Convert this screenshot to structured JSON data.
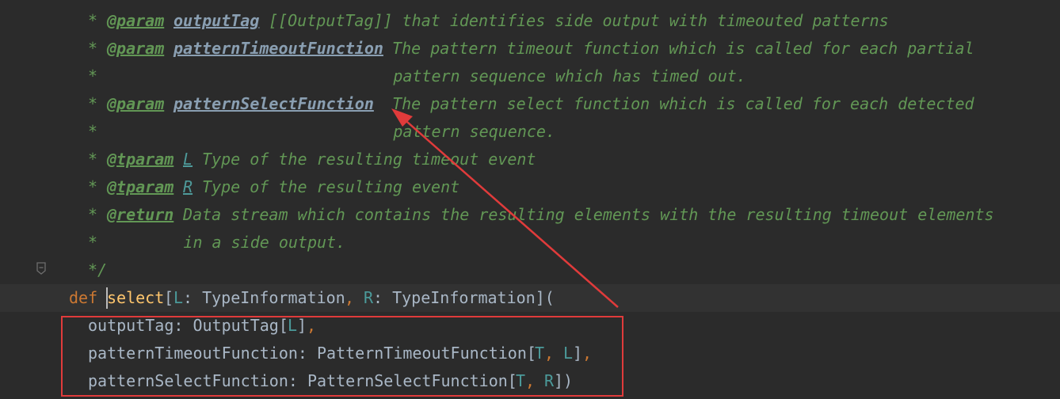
{
  "lines": [
    {
      "text": "* @param outputTag [[OutputTag]] that identifies side output with timeouted patterns",
      "tokens": [
        {
          "kind": "doc",
          "text": "* "
        },
        {
          "kind": "doctag",
          "text": "@param"
        },
        {
          "kind": "doc",
          "text": " "
        },
        {
          "kind": "docparam",
          "text": "outputTag"
        },
        {
          "kind": "doc",
          "text": " [[OutputTag]] that identifies side output with timeouted patterns"
        }
      ]
    },
    {
      "tokens": [
        {
          "kind": "doc",
          "text": "* "
        },
        {
          "kind": "doctag",
          "text": "@param"
        },
        {
          "kind": "doc",
          "text": " "
        },
        {
          "kind": "docparam",
          "text": "patternTimeoutFunction"
        },
        {
          "kind": "doc",
          "text": " The pattern timeout function which is called for each partial"
        }
      ]
    },
    {
      "tokens": [
        {
          "kind": "doc",
          "text": "*                               pattern sequence which has timed out."
        }
      ]
    },
    {
      "tokens": [
        {
          "kind": "doc",
          "text": "* "
        },
        {
          "kind": "doctag",
          "text": "@param"
        },
        {
          "kind": "doc",
          "text": " "
        },
        {
          "kind": "docparam",
          "text": "patternSelectFunction"
        },
        {
          "kind": "doc",
          "text": "  The pattern select function which is called for each detected"
        }
      ]
    },
    {
      "tokens": [
        {
          "kind": "doc",
          "text": "*                               pattern sequence."
        }
      ]
    },
    {
      "tokens": [
        {
          "kind": "doc",
          "text": "* "
        },
        {
          "kind": "doctag",
          "text": "@tparam"
        },
        {
          "kind": "doc",
          "text": " "
        },
        {
          "kind": "doctype",
          "text": "L"
        },
        {
          "kind": "doc",
          "text": " Type of the resulting timeout event"
        }
      ]
    },
    {
      "tokens": [
        {
          "kind": "doc",
          "text": "* "
        },
        {
          "kind": "doctag",
          "text": "@tparam"
        },
        {
          "kind": "doc",
          "text": " "
        },
        {
          "kind": "doctype",
          "text": "R"
        },
        {
          "kind": "doc",
          "text": " Type of the resulting event"
        }
      ]
    },
    {
      "tokens": [
        {
          "kind": "doc",
          "text": "* "
        },
        {
          "kind": "doctag",
          "text": "@return"
        },
        {
          "kind": "doc",
          "text": " Data stream which contains the resulting elements with the resulting timeout elements"
        }
      ]
    },
    {
      "tokens": [
        {
          "kind": "doc",
          "text": "*         in a side output."
        }
      ]
    },
    {
      "tokens": [
        {
          "kind": "doc",
          "text": "*/"
        }
      ]
    },
    {
      "tokens": [
        {
          "kind": "kw",
          "text": "def "
        },
        {
          "kind": "fn",
          "text": "select"
        },
        {
          "kind": "txt",
          "text": "["
        },
        {
          "kind": "tp",
          "text": "L"
        },
        {
          "kind": "txt",
          "text": ": TypeInformation"
        },
        {
          "kind": "punc",
          "text": ", "
        },
        {
          "kind": "tp",
          "text": "R"
        },
        {
          "kind": "txt",
          "text": ": TypeInformation]("
        }
      ]
    },
    {
      "tokens": [
        {
          "kind": "txt",
          "text": "outputTag: OutputTag["
        },
        {
          "kind": "tp",
          "text": "L"
        },
        {
          "kind": "txt",
          "text": "]"
        },
        {
          "kind": "punc",
          "text": ","
        }
      ]
    },
    {
      "tokens": [
        {
          "kind": "txt",
          "text": "patternTimeoutFunction: PatternTimeoutFunction["
        },
        {
          "kind": "tp",
          "text": "T"
        },
        {
          "kind": "punc",
          "text": ", "
        },
        {
          "kind": "tp",
          "text": "L"
        },
        {
          "kind": "txt",
          "text": "]"
        },
        {
          "kind": "punc",
          "text": ","
        }
      ]
    },
    {
      "tokens": [
        {
          "kind": "txt",
          "text": "patternSelectFunction: PatternSelectFunction["
        },
        {
          "kind": "tp",
          "text": "T"
        },
        {
          "kind": "punc",
          "text": ", "
        },
        {
          "kind": "tp",
          "text": "R"
        },
        {
          "kind": "txt",
          "text": "])"
        }
      ]
    }
  ],
  "icons": {
    "fold": "fold-marker-icon"
  },
  "annotation_color": "#e03b3b"
}
